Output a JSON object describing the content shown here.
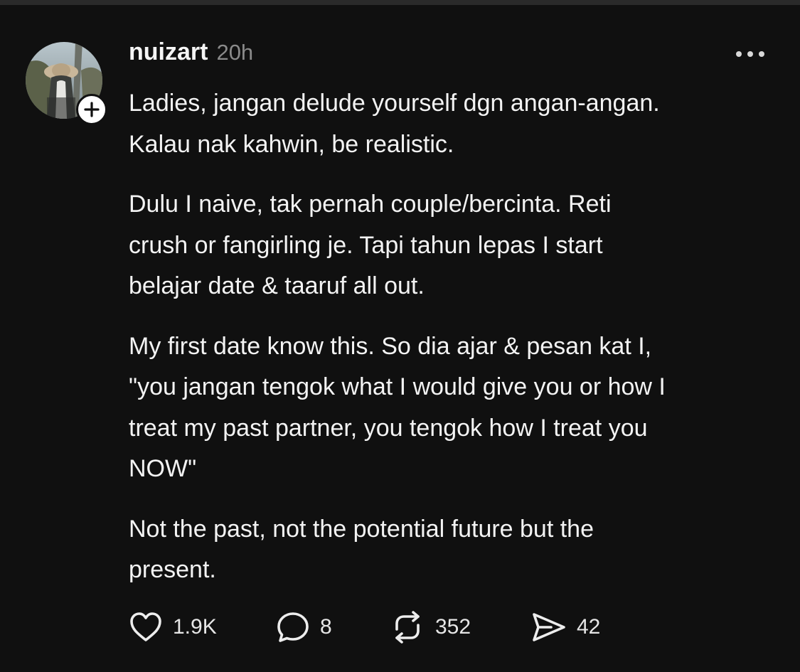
{
  "post": {
    "username": "nuizart",
    "timestamp": "20h",
    "paragraphs": [
      {
        "lines": [
          "Ladies, jangan delude yourself dgn angan-angan.",
          "Kalau nak kahwin, be realistic."
        ]
      },
      {
        "lines": [
          "Dulu I naive, tak pernah couple/bercinta. Reti",
          "crush or fangirling je. Tapi tahun lepas I start",
          "belajar date & taaruf all out."
        ]
      },
      {
        "lines": [
          "My first date know this. So dia ajar & pesan kat I,",
          "\"you jangan tengok what I would give you or how I",
          "treat my past partner, you tengok how I treat you",
          "NOW\""
        ]
      },
      {
        "lines": [
          "Not the past, not the potential future but the",
          "present."
        ]
      }
    ],
    "actions": {
      "likes": "1.9K",
      "comments": "8",
      "reposts": "352",
      "shares": "42"
    }
  },
  "icons": {
    "avatar": "profile-photo",
    "follow": "plus-icon",
    "more": "more-dots-icon",
    "like": "heart-icon",
    "comment": "comment-bubble-icon",
    "repost": "repost-icon",
    "share": "send-icon"
  },
  "colors": {
    "background": "#101010",
    "text": "#f3f3f3",
    "muted": "#8a8a8a",
    "badge": "#ffffff"
  }
}
